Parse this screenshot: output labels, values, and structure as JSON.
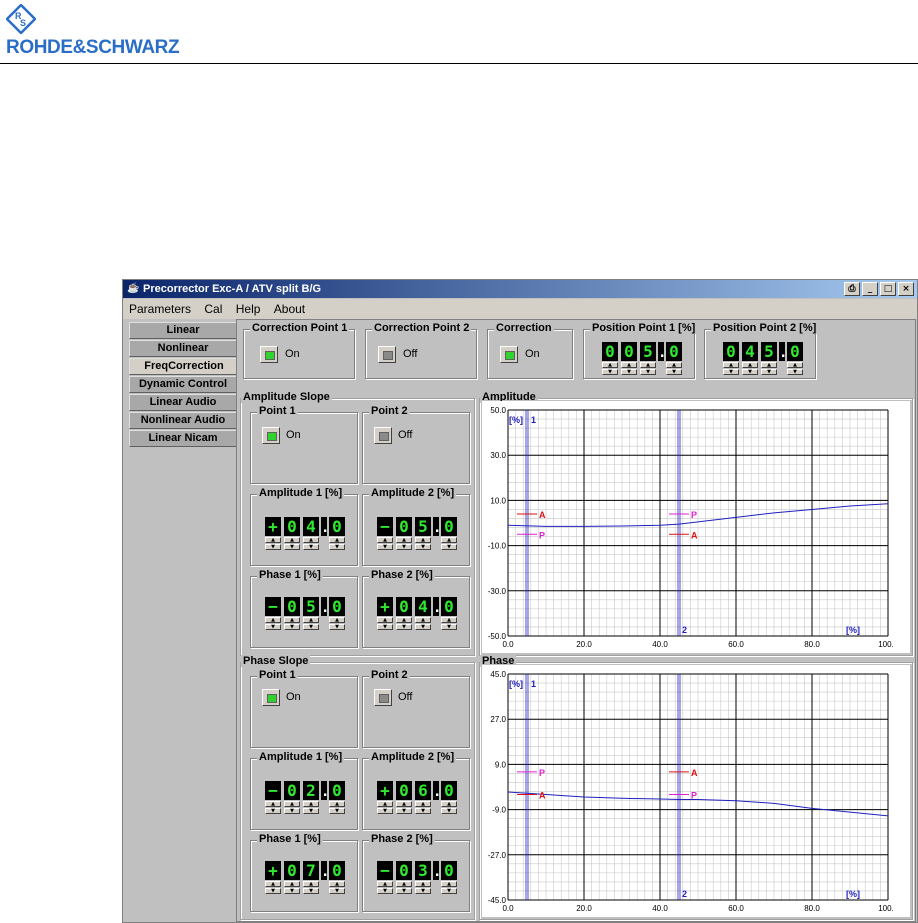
{
  "brand": {
    "name": "ROHDE&SCHWARZ",
    "blue": "#2a6ec7"
  },
  "window": {
    "title": "Precorrector Exc-A / ATV split B/G",
    "buttons": [
      "print-icon",
      "minimize-icon",
      "maximize-icon",
      "close-icon"
    ]
  },
  "menu": [
    "Parameters",
    "Cal",
    "Help",
    "About"
  ],
  "tabs": [
    "Linear",
    "Nonlinear",
    "FreqCorrection",
    "Dynamic Control",
    "Linear Audio",
    "Nonlinear Audio",
    "Linear Nicam"
  ],
  "selected_tab": "FreqCorrection",
  "top": {
    "cp1": {
      "title": "Correction Point 1",
      "state": "On"
    },
    "cp2": {
      "title": "Correction Point 2",
      "state": "Off"
    },
    "corr": {
      "title": "Correction",
      "state": "On"
    },
    "pos1": {
      "title": "Position Point 1 [%]",
      "digits": [
        "0",
        "0",
        "5",
        ".",
        "0"
      ]
    },
    "pos2": {
      "title": "Position Point 2 [%]",
      "digits": [
        "0",
        "4",
        "5",
        ".",
        "0"
      ]
    }
  },
  "amp_slope": {
    "title": "Amplitude Slope",
    "p1": {
      "title": "Point 1",
      "state": "On"
    },
    "p2": {
      "title": "Point 2",
      "state": "Off"
    },
    "a1": {
      "title": "Amplitude 1 [%]",
      "digits": [
        "+",
        "0",
        "4",
        ".",
        "0"
      ]
    },
    "a2": {
      "title": "Amplitude 2 [%]",
      "digits": [
        "-",
        "0",
        "5",
        ".",
        "0"
      ]
    },
    "ph1": {
      "title": "Phase 1 [%]",
      "digits": [
        "-",
        "0",
        "5",
        ".",
        "0"
      ]
    },
    "ph2": {
      "title": "Phase 2 [%]",
      "digits": [
        "+",
        "0",
        "4",
        ".",
        "0"
      ]
    }
  },
  "phase_slope": {
    "title": "Phase Slope",
    "p1": {
      "title": "Point 1",
      "state": "On"
    },
    "p2": {
      "title": "Point 2",
      "state": "Off"
    },
    "a1": {
      "title": "Amplitude 1 [%]",
      "digits": [
        "-",
        "0",
        "2",
        ".",
        "0"
      ]
    },
    "a2": {
      "title": "Amplitude 2 [%]",
      "digits": [
        "+",
        "0",
        "6",
        ".",
        "0"
      ]
    },
    "ph1": {
      "title": "Phase 1 [%]",
      "digits": [
        "+",
        "0",
        "7",
        ".",
        "0"
      ]
    },
    "ph2": {
      "title": "Phase 2 [%]",
      "digits": [
        "-",
        "0",
        "3",
        ".",
        "0"
      ]
    }
  },
  "colors": {
    "led_on": "#2fd22f",
    "led_off": "#8a8a8a",
    "digit": "#2fe82f",
    "curve": "#2020c0",
    "marker_a": "#dd1111",
    "marker_p": "#e020d0"
  },
  "chart_data": [
    {
      "type": "line",
      "title": "Amplitude",
      "ylim": [
        -50,
        50
      ],
      "xlim": [
        0,
        100
      ],
      "yticks": [
        "50.0",
        "30.0",
        "10.0",
        "-10.0",
        "-30.0",
        "-50.0"
      ],
      "xticks": [
        "0.0",
        "20.0",
        "40.0",
        "60.0",
        "80.0",
        "100."
      ],
      "unit_label": "[%]",
      "cursor_labels": [
        "1",
        "2"
      ],
      "cursors": [
        5,
        45
      ],
      "series": [
        {
          "x": [
            0,
            10,
            20,
            30,
            40,
            45,
            50,
            60,
            70,
            80,
            90,
            100
          ],
          "y": [
            -1,
            -1.5,
            -1.5,
            -1.3,
            -1,
            -0.5,
            0.5,
            2.5,
            4.5,
            6,
            7.5,
            8.5
          ]
        }
      ],
      "markers": [
        {
          "label": "A",
          "x": 5,
          "y": 4
        },
        {
          "label": "P",
          "x": 5,
          "y": -5
        },
        {
          "label": "P",
          "x": 45,
          "y": 4
        },
        {
          "label": "A",
          "x": 45,
          "y": -5
        }
      ]
    },
    {
      "type": "line",
      "title": "Phase",
      "ylim": [
        -45,
        45
      ],
      "xlim": [
        0,
        100
      ],
      "yticks": [
        "45.0",
        "27.0",
        "9.0",
        "-9.0",
        "-27.0",
        "-45.0"
      ],
      "xticks": [
        "0.0",
        "20.0",
        "40.0",
        "60.0",
        "80.0",
        "100."
      ],
      "unit_label": "[%]",
      "cursor_labels": [
        "1",
        "2"
      ],
      "cursors": [
        5,
        45
      ],
      "series": [
        {
          "x": [
            0,
            5,
            10,
            20,
            30,
            40,
            45,
            50,
            60,
            70,
            80,
            90,
            100
          ],
          "y": [
            -2,
            -2.5,
            -3,
            -4,
            -4.5,
            -4.8,
            -5,
            -5,
            -5.5,
            -6.5,
            -8.5,
            -10,
            -11.5
          ]
        }
      ],
      "markers": [
        {
          "label": "P",
          "x": 5,
          "y": 6
        },
        {
          "label": "A",
          "x": 5,
          "y": -3
        },
        {
          "label": "A",
          "x": 45,
          "y": 6
        },
        {
          "label": "P",
          "x": 45,
          "y": -3
        }
      ]
    }
  ]
}
